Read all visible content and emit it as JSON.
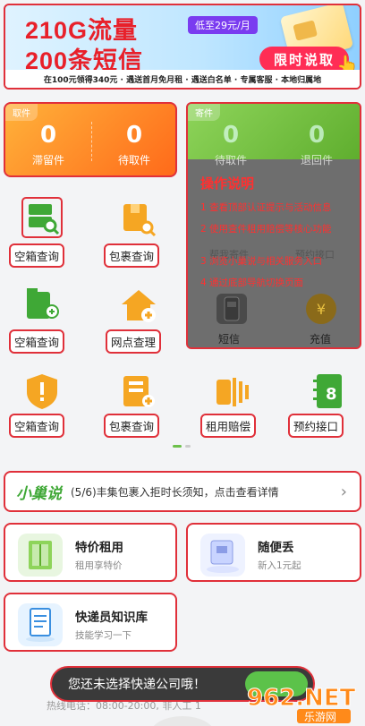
{
  "banner": {
    "line1": "210G流量",
    "line2": "200条短信",
    "price": "低至29元/月",
    "cta": "限时说取",
    "footer": "在100元领得340元 · 遇送首月免月租 · 遇送白名单 · 专属客服 · 本地归属地"
  },
  "parcel": {
    "tag": "取件",
    "stats": [
      {
        "value": "0",
        "label": "滞留件"
      },
      {
        "value": "0",
        "label": "待取件"
      }
    ]
  },
  "send": {
    "tag": "寄件",
    "stats": [
      {
        "value": "0",
        "label": "待取件"
      },
      {
        "value": "0",
        "label": "退回件"
      }
    ],
    "hidden_labels": [
      "帮我寄件",
      "预约接口"
    ],
    "items": [
      {
        "label": "短信",
        "icon": "phone-msg-icon"
      },
      {
        "label": "充值",
        "icon": "coin-icon"
      }
    ]
  },
  "overlay": {
    "title": "操作说明",
    "steps": [
      "1 查看顶部认证提示与活动信息",
      "2 使用查件租用赔偿等核心功能",
      "3 浏览小巢说与相关服务入口",
      "4 通过底部导航切换页面"
    ]
  },
  "grid": [
    {
      "label": "空箱查询",
      "icon": "box-search-icon",
      "color": "#3fa836"
    },
    {
      "label": "包裹查询",
      "icon": "parcel-search-icon",
      "color": "#f5a623"
    },
    {
      "label": "空箱查询",
      "icon": "box-plug-icon",
      "color": "#3fa836"
    },
    {
      "label": "网点查理",
      "icon": "home-plus-icon",
      "color": "#f5a623"
    },
    {
      "label": "空箱查询",
      "icon": "shield-alert-icon",
      "color": "#f5a623"
    },
    {
      "label": "包裹查询",
      "icon": "parcel-plus-icon",
      "color": "#f5a623"
    },
    {
      "label": "租用赔偿",
      "icon": "compensation-icon",
      "color": "#f5a623"
    },
    {
      "label": "预约接口",
      "icon": "notebook-icon",
      "color": "#3fa836"
    }
  ],
  "news": {
    "brand": "小巢说",
    "text": "(5/6)丰集包裹入拒时长须知，点击查看详情"
  },
  "services": [
    {
      "title": "特价租用",
      "sub": "租用享特价"
    },
    {
      "title": "随便丢",
      "sub": "新入1元起"
    },
    {
      "title": "快递员知识库",
      "sub": "技能学习一下"
    }
  ],
  "toast": {
    "text": "您还未选择快递公司哦！"
  },
  "hotline": "热线电话：08:00-20:00, 非人工 1",
  "watermark": {
    "brand": "962.NET",
    "sub": "乐游网"
  },
  "colors": {
    "accent": "#3fa836",
    "highlight": "#e0303a",
    "orange": "#ff6a1a"
  }
}
